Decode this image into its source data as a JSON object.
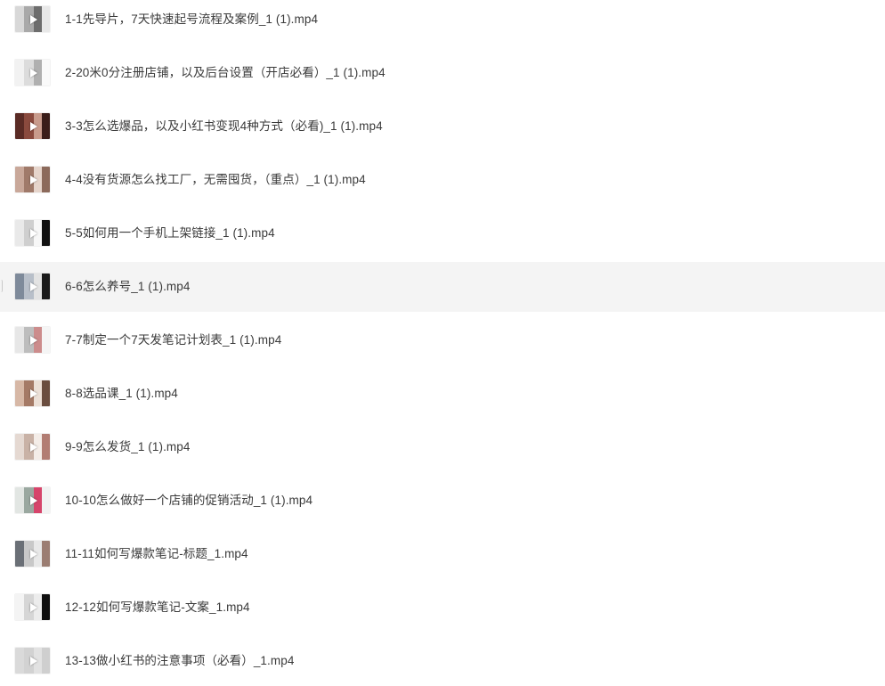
{
  "files": [
    {
      "name": "1-1先导片，7天快速起号流程及案例_1 (1).mp4",
      "thumbnail": {
        "icon": "video-thumbnail",
        "colors": [
          "#d8d8d8",
          "#a9a9a9",
          "#6d6d6d",
          "#e8e8e8"
        ]
      }
    },
    {
      "name": "2-20米0分注册店铺，以及后台设置（开店必看）_1 (1).mp4",
      "thumbnail": {
        "icon": "video-thumbnail",
        "colors": [
          "#f2f2f2",
          "#dcdcdc",
          "#b0b0b0",
          "#fafafa"
        ]
      }
    },
    {
      "name": "3-3怎么选爆品，以及小红书变现4种方式（必看)_1 (1).mp4",
      "thumbnail": {
        "icon": "video-thumbnail",
        "colors": [
          "#5a2b25",
          "#8a4a3e",
          "#c89b8c",
          "#3a1d19"
        ]
      }
    },
    {
      "name": "4-4没有货源怎么找工厂，无需囤货，（重点）_1 (1).mp4",
      "thumbnail": {
        "icon": "video-thumbnail",
        "colors": [
          "#c9a89a",
          "#a07a6a",
          "#e6d5cc",
          "#8c6a5b"
        ]
      }
    },
    {
      "name": "5-5如何用一个手机上架链接_1 (1).mp4",
      "thumbnail": {
        "icon": "video-thumbnail",
        "colors": [
          "#e9e9e9",
          "#cfcfcf",
          "#f7f7f7",
          "#111111"
        ]
      }
    },
    {
      "name": "6-6怎么养号_1 (1).mp4",
      "thumbnail": {
        "icon": "video-thumbnail",
        "colors": [
          "#7e8a9a",
          "#b8bfc9",
          "#e3e3e3",
          "#1a1a1a"
        ]
      }
    },
    {
      "name": "7-7制定一个7天发笔记计划表_1 (1).mp4",
      "thumbnail": {
        "icon": "video-thumbnail",
        "colors": [
          "#e7e7e7",
          "#bdbdbd",
          "#cc8c8c",
          "#f5f5f5"
        ]
      }
    },
    {
      "name": "8-8选品课_1 (1).mp4",
      "thumbnail": {
        "icon": "video-thumbnail",
        "colors": [
          "#d7b8a6",
          "#a57a66",
          "#ece0d7",
          "#6a4d3f"
        ]
      }
    },
    {
      "name": "9-9怎么发货_1 (1).mp4",
      "thumbnail": {
        "icon": "video-thumbnail",
        "colors": [
          "#e5d9d2",
          "#c9b2a6",
          "#f4ede8",
          "#b27d73"
        ]
      }
    },
    {
      "name": "10-10怎么做好一个店铺的促销活动_1 (1).mp4",
      "thumbnail": {
        "icon": "video-thumbnail",
        "colors": [
          "#e2e6e3",
          "#9aa8a0",
          "#d6456b",
          "#f2f2f2"
        ]
      }
    },
    {
      "name": "11-11如何写爆款笔记-标题_1.mp4",
      "thumbnail": {
        "icon": "video-thumbnail",
        "colors": [
          "#6a6f76",
          "#c8c8c8",
          "#e8e8e8",
          "#9b7d72"
        ]
      }
    },
    {
      "name": "12-12如何写爆款笔记-文案_1.mp4",
      "thumbnail": {
        "icon": "video-thumbnail",
        "colors": [
          "#f4f4f4",
          "#d6d6d6",
          "#ececec",
          "#0f0f0f"
        ]
      }
    },
    {
      "name": "13-13做小红书的注意事项（必看）_1.mp4",
      "thumbnail": {
        "icon": "video-thumbnail",
        "colors": [
          "#dadada",
          "#d2d2d2",
          "#e2e2e2",
          "#cfcfcf"
        ]
      }
    }
  ],
  "hovered_index": 5,
  "colors": {
    "hover_row": "#f4f4f4",
    "text": "#3a3a3a",
    "play_icon": "#ffffff"
  }
}
